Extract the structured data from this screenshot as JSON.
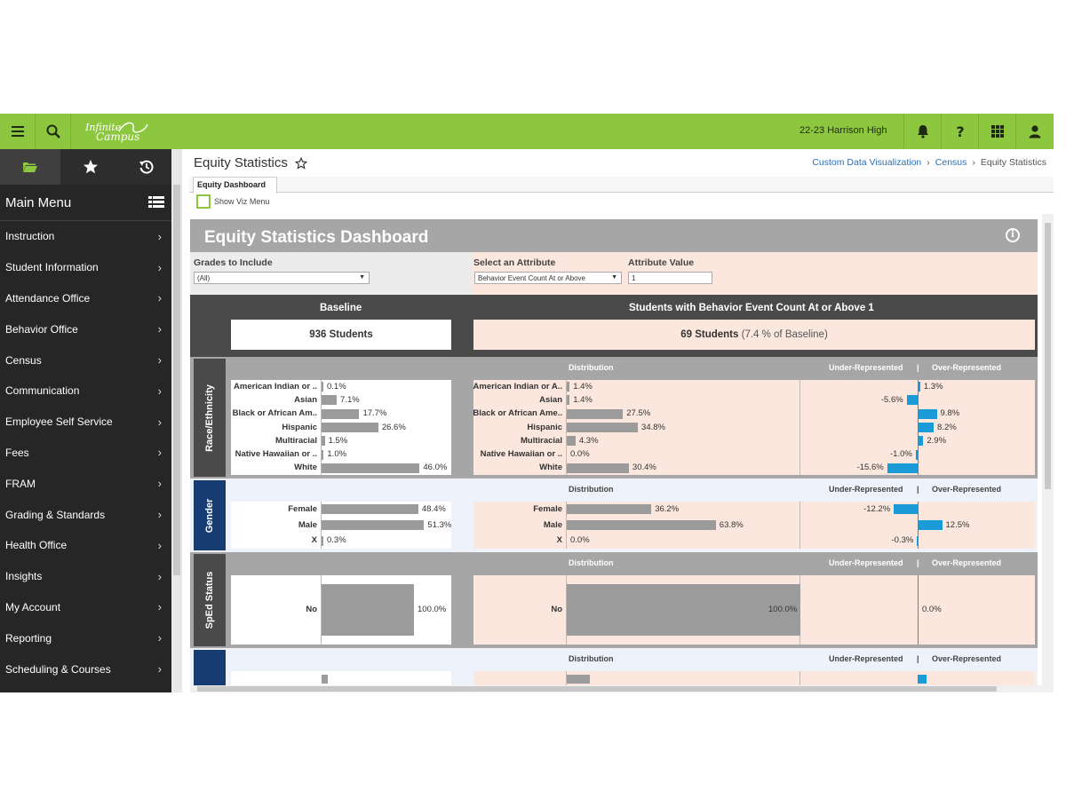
{
  "topbar": {
    "logo_line1": "Infinite",
    "logo_line2": "Campus",
    "school": "22-23 Harrison High",
    "accent": "#8dc63f"
  },
  "sidebar": {
    "title": "Main Menu",
    "items": [
      {
        "label": "Instruction"
      },
      {
        "label": "Student Information"
      },
      {
        "label": "Attendance Office"
      },
      {
        "label": "Behavior Office"
      },
      {
        "label": "Census"
      },
      {
        "label": "Communication"
      },
      {
        "label": "Employee Self Service"
      },
      {
        "label": "Fees"
      },
      {
        "label": "FRAM"
      },
      {
        "label": "Grading & Standards"
      },
      {
        "label": "Health Office"
      },
      {
        "label": "Insights"
      },
      {
        "label": "My Account"
      },
      {
        "label": "Reporting"
      },
      {
        "label": "Scheduling & Courses"
      }
    ]
  },
  "page": {
    "title": "Equity Statistics",
    "breadcrumb": [
      "Custom Data Visualization",
      "Census",
      "Equity Statistics"
    ],
    "tab": "Equity Dashboard",
    "show_viz_menu": "Show Viz Menu"
  },
  "dashboard": {
    "title": "Equity Statistics Dashboard",
    "filters": {
      "grades_label": "Grades to Include",
      "grades_value": "(All)",
      "attribute_label": "Select an Attribute",
      "attribute_value": "Behavior Event Count At or Above",
      "attr_value_label": "Attribute Value",
      "attr_value_value": "1"
    },
    "baseline_label": "Baseline",
    "baseline_count": "936 Students",
    "target_label": "Students with Behavior Event Count At or Above 1",
    "target_count": "69 Students",
    "target_pct": "(7.4 % of Baseline)",
    "col_distribution": "Distribution",
    "col_under": "Under-Represented",
    "col_sep": "|",
    "col_over": "Over-Represented",
    "sections": {
      "race": {
        "label": "Race/Ethnicity",
        "cats_left": [
          "American Indian or ..",
          "Asian",
          "Black or African Am..",
          "Hispanic",
          "Multiracial",
          "Native Hawaiian or ..",
          "White"
        ],
        "cats_right": [
          "American Indian or A..",
          "Asian",
          "Black or African Ame..",
          "Hispanic",
          "Multiracial",
          "Native Hawaiian or ..",
          "White"
        ],
        "baseline": [
          0.1,
          7.1,
          17.7,
          26.6,
          1.5,
          1.0,
          46.0
        ],
        "baseline_labels": [
          "0.1%",
          "7.1%",
          "17.7%",
          "26.6%",
          "1.5%",
          "1.0%",
          "46.0%"
        ],
        "dist": [
          1.4,
          1.4,
          27.5,
          34.8,
          4.3,
          0.0,
          30.4
        ],
        "dist_labels": [
          "1.4%",
          "1.4%",
          "27.5%",
          "34.8%",
          "4.3%",
          "0.0%",
          "30.4%"
        ],
        "diff": [
          1.3,
          -5.6,
          9.8,
          8.2,
          2.9,
          -1.0,
          -15.6
        ],
        "diff_labels": [
          "1.3%",
          "-5.6%",
          "9.8%",
          "8.2%",
          "2.9%",
          "-1.0%",
          "-15.6%"
        ]
      },
      "gender": {
        "label": "Gender",
        "cats": [
          "Female",
          "Male",
          "X"
        ],
        "baseline": [
          48.4,
          51.3,
          0.3
        ],
        "baseline_labels": [
          "48.4%",
          "51.3%",
          "0.3%"
        ],
        "dist": [
          36.2,
          63.8,
          0.0
        ],
        "dist_labels": [
          "36.2%",
          "63.8%",
          "0.0%"
        ],
        "diff": [
          -12.2,
          12.5,
          -0.3
        ],
        "diff_labels": [
          "-12.2%",
          "12.5%",
          "-0.3%"
        ]
      },
      "sped": {
        "label": "SpEd Status",
        "cats": [
          "No"
        ],
        "baseline": [
          100.0
        ],
        "baseline_labels": [
          "100.0%"
        ],
        "dist": [
          100.0
        ],
        "dist_labels": [
          "100.0%"
        ],
        "diff": [
          0.0
        ],
        "diff_labels": [
          "0.0%"
        ]
      }
    }
  }
}
